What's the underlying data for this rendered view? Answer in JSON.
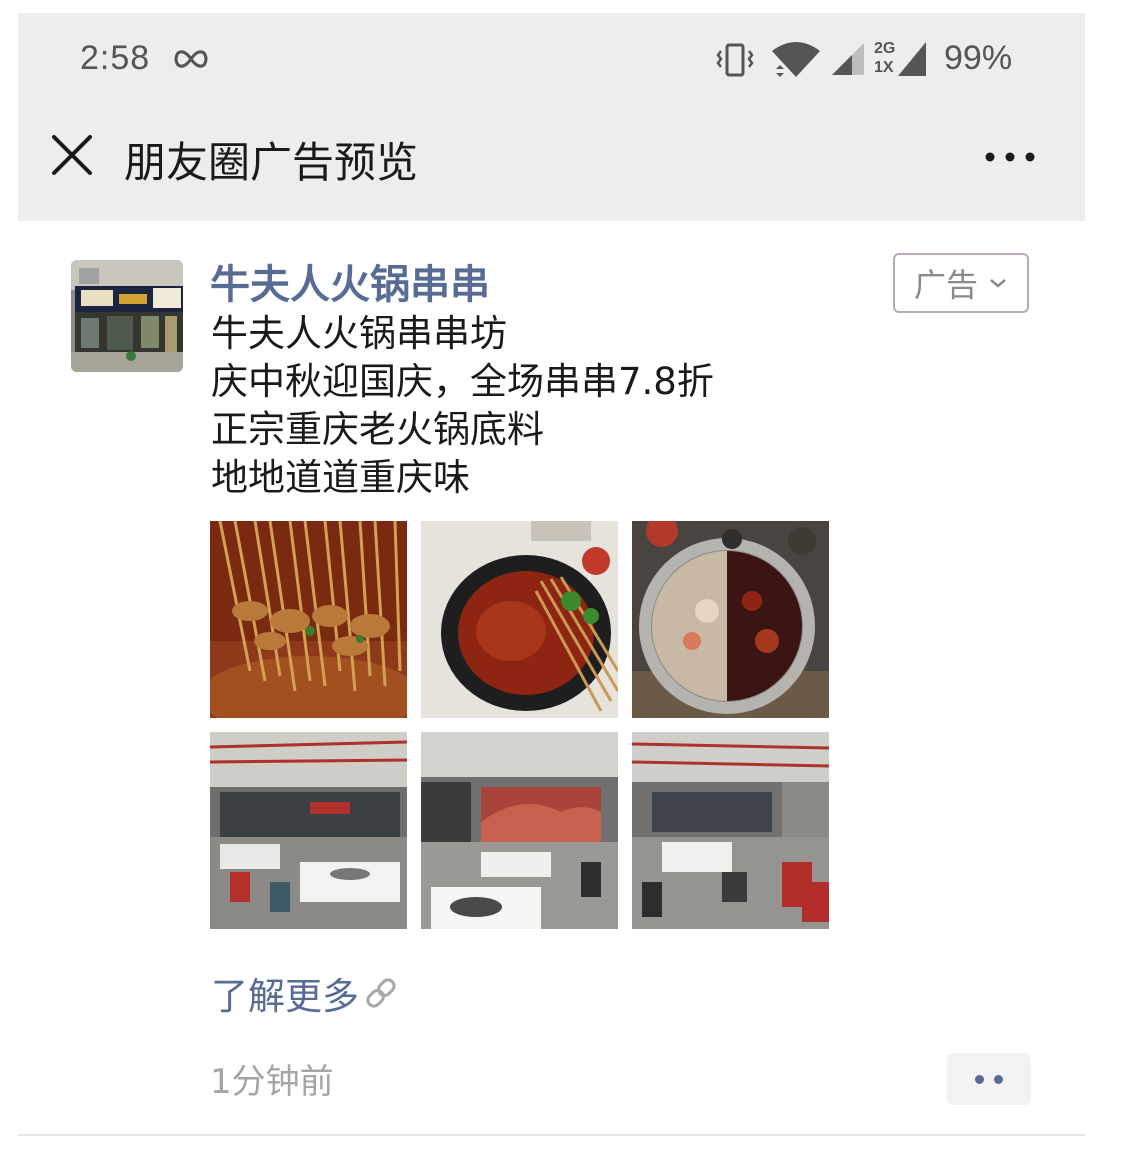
{
  "status_bar": {
    "time": "2:58",
    "battery": "99%",
    "network_top": "2G",
    "network_bottom": "1X",
    "icons": [
      "infinity-icon",
      "vibrate-icon",
      "wifi-icon",
      "signal-icon",
      "signal-2g-icon"
    ]
  },
  "header": {
    "title": "朋友圈广告预览",
    "close_icon": "close-icon",
    "more_icon": "more-icon"
  },
  "post": {
    "advertiser": "牛夫人火锅串串",
    "ad_tag": "广告",
    "body_lines": [
      "牛夫人火锅串串坊",
      "庆中秋迎国庆，全场串串7.8折",
      "正宗重庆老火锅底料",
      "地地道道重庆味"
    ],
    "photos": [
      "skewers-in-broth-photo",
      "skewer-pot-photo",
      "twin-hotpot-photo",
      "dining-hall-photo-1",
      "dining-hall-photo-2",
      "dining-hall-photo-3"
    ],
    "learn_more": "了解更多",
    "timestamp": "1分钟前"
  },
  "colors": {
    "link": "#576b95",
    "header_bg": "#ededed",
    "timestamp": "#a5a5a5"
  }
}
